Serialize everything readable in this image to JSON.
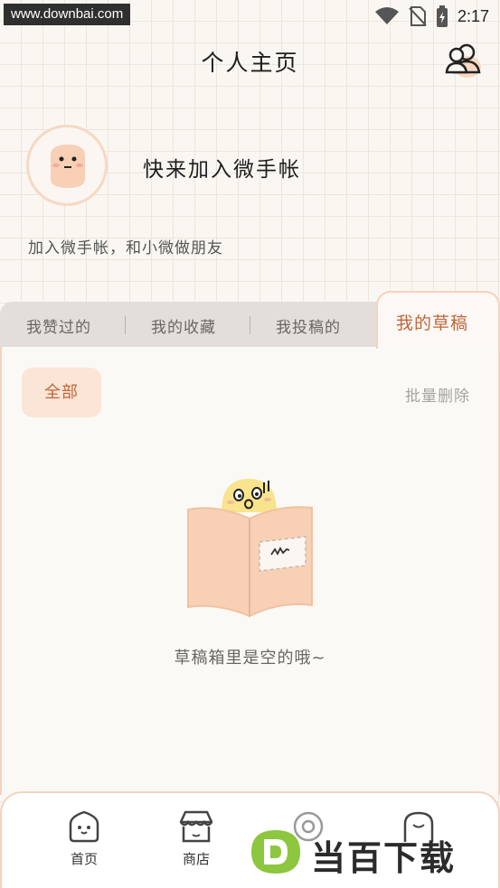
{
  "status_bar": {
    "watermark_url": "www.downbai.com",
    "time": "2:17"
  },
  "header": {
    "title": "个人主页"
  },
  "profile": {
    "name": "快来加入微手帐",
    "subtitle": "加入微手帐，和小微做朋友"
  },
  "tabs": [
    {
      "label": "我赞过的",
      "active": false
    },
    {
      "label": "我的收藏",
      "active": false
    },
    {
      "label": "我投稿的",
      "active": false
    },
    {
      "label": "我的草稿",
      "active": true
    }
  ],
  "filters": {
    "all_label": "全部",
    "batch_delete_label": "批量删除"
  },
  "empty_state": {
    "text": "草稿箱里是空的哦~"
  },
  "bottom_nav": {
    "items": [
      {
        "label": "首页",
        "icon": "home-icon"
      },
      {
        "label": "商店",
        "icon": "store-icon"
      },
      {
        "label": "",
        "icon": "camera-icon"
      },
      {
        "label": "",
        "icon": "face-icon"
      }
    ]
  },
  "watermark_logo": {
    "text": "当百下载"
  },
  "colors": {
    "accent": "#c0673a",
    "accent_light": "#fbe5d6",
    "border": "#f4d3bd",
    "tab_bar": "#e3dedb",
    "background": "#faf7f2"
  }
}
